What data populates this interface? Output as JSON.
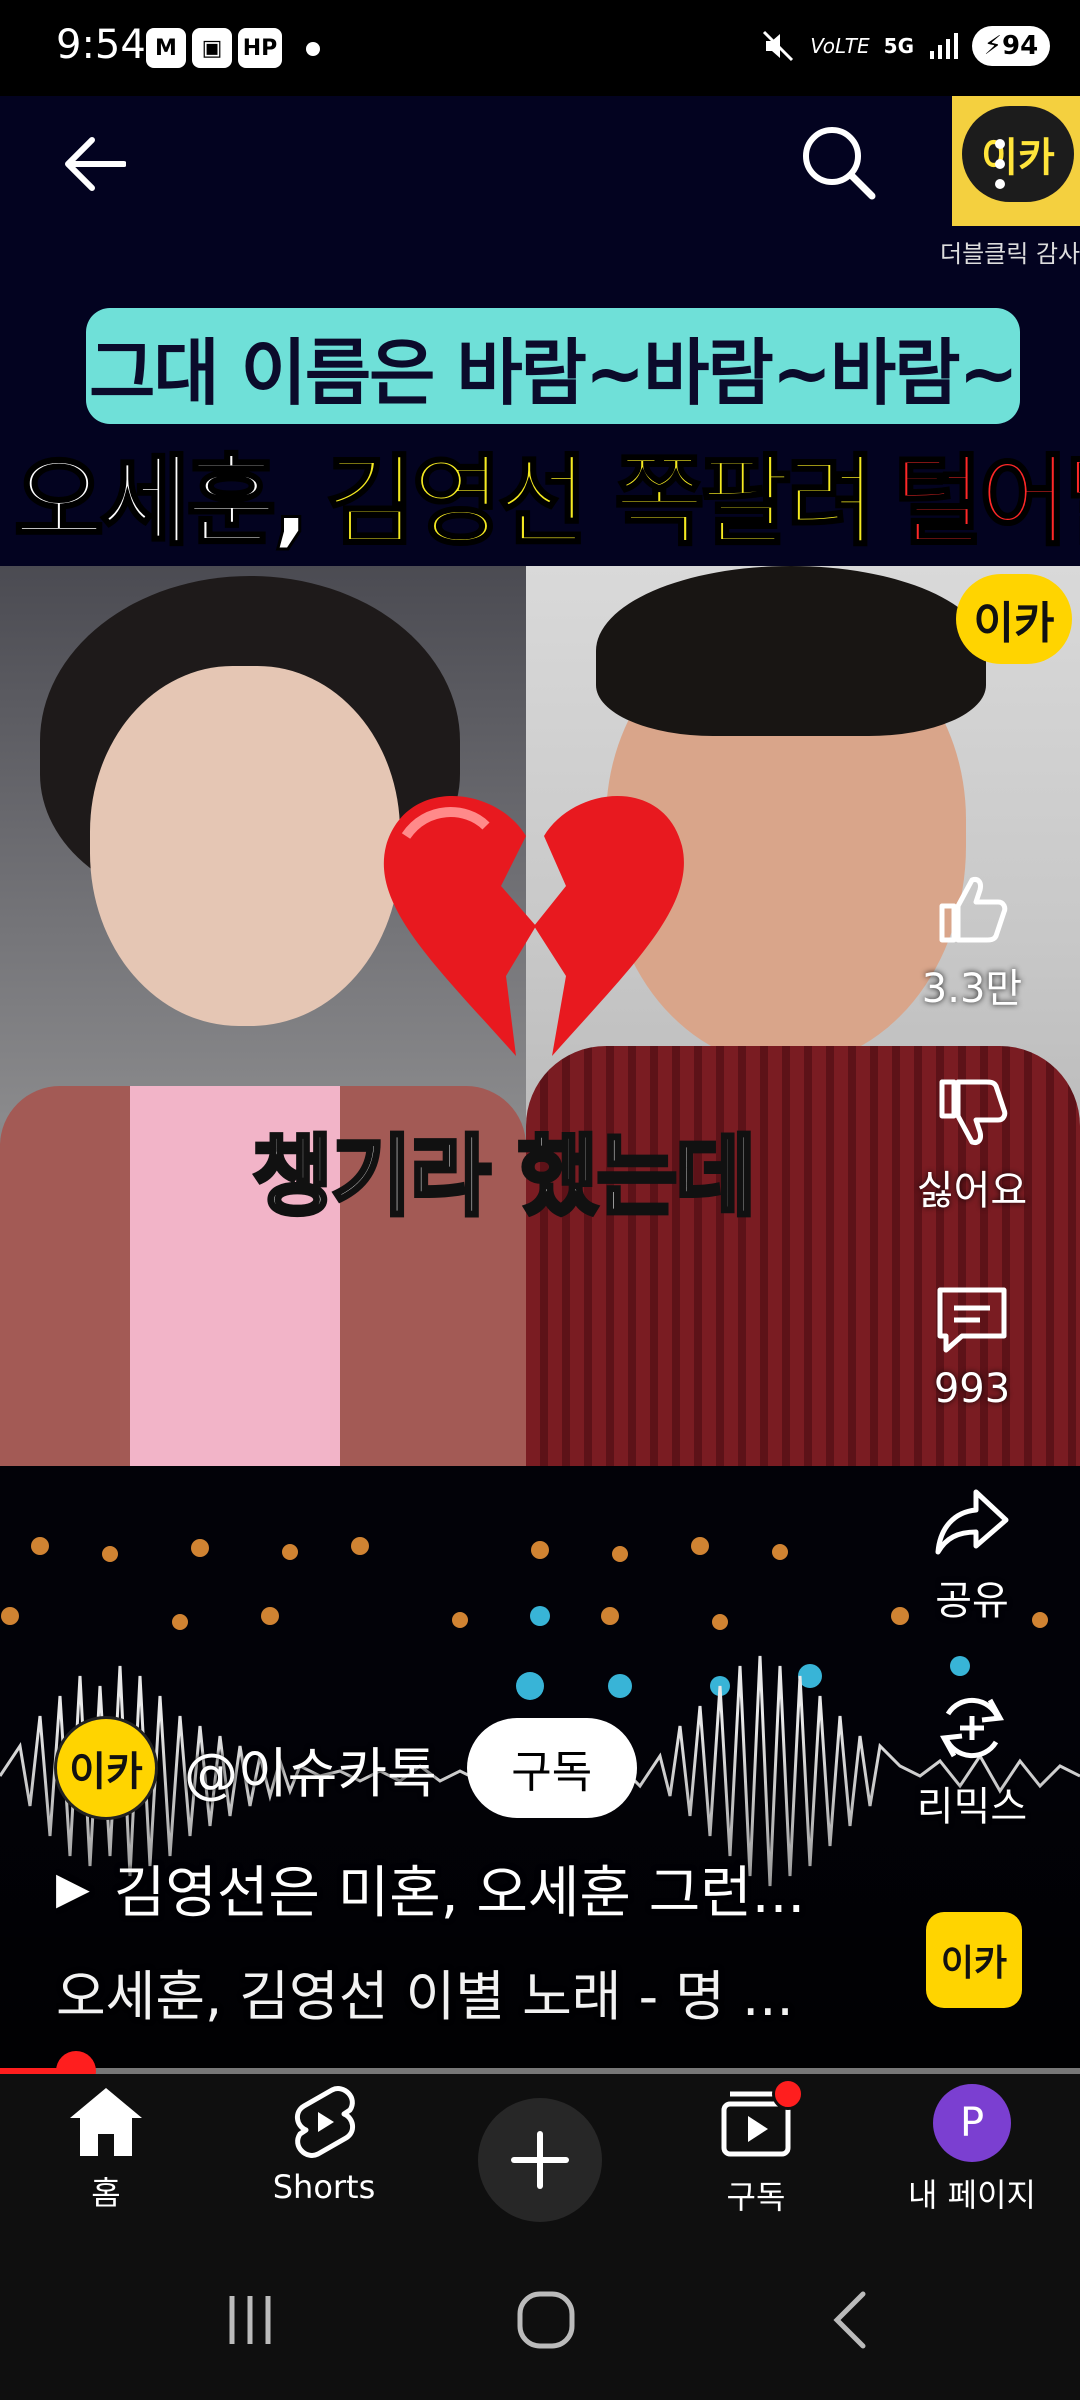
{
  "status_bar": {
    "time": "9:54",
    "badges": [
      "M",
      "▣",
      "HP"
    ],
    "network": "VoLTE",
    "network_gen": "5G",
    "battery": "94"
  },
  "video": {
    "caption_top": "그대 이름은 바람~바람~바람~",
    "caption_title": {
      "part1": "오세훈,",
      "part2": "김영선 쪽팔려",
      "part3": "털어달라"
    },
    "caption_bottom": "챙기라 했는데",
    "logo_text": "이카",
    "logo_sub": "더블클릭 감사"
  },
  "actions": {
    "like_count": "3.3만",
    "dislike_label": "싫어요",
    "comment_count": "993",
    "share_label": "공유",
    "remix_label": "리믹스"
  },
  "channel": {
    "avatar_text": "이카",
    "handle": "@이슈카톡",
    "subscribe_label": "구독"
  },
  "video_title": "김영선은 미혼, 오세훈 그런...",
  "video_desc": "오세훈, 김영선 이별 노래 - 명 ...",
  "sound_logo": "이카",
  "progress": 0.07,
  "bottom_nav": {
    "home": "홈",
    "shorts": "Shorts",
    "subscriptions": "구독",
    "profile_initial": "P",
    "profile": "내 페이지"
  },
  "colors": {
    "accent_red": "#ff1e1e",
    "brand_yellow": "#ffd400",
    "caption_cyan": "#6fe0d8"
  }
}
